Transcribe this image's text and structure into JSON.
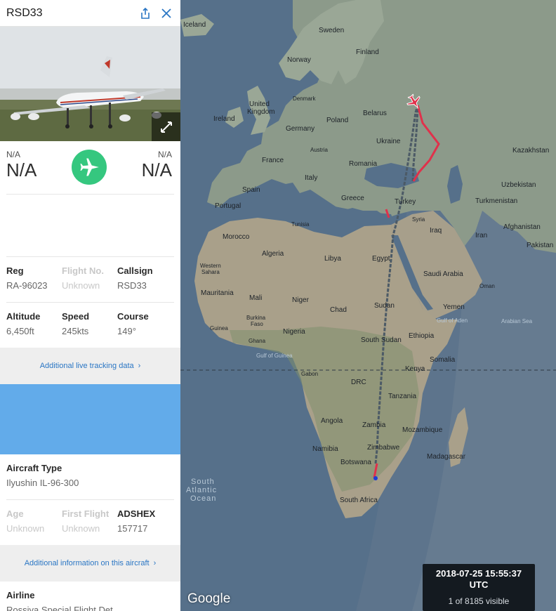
{
  "panel": {
    "title": "RSD33",
    "icons": [
      "share-icon",
      "close-icon",
      "expand-icon",
      "plane-icon"
    ],
    "origin": {
      "code": "N/A",
      "name": "N/A"
    },
    "destination": {
      "code": "N/A",
      "name": "N/A"
    },
    "status_color": "#35c77f",
    "info_row1": [
      {
        "label": "Reg",
        "value": "RA-96023",
        "dim": false
      },
      {
        "label": "Flight No.",
        "value": "Unknown",
        "dim": true
      },
      {
        "label": "Callsign",
        "value": "RSD33",
        "dim": false
      }
    ],
    "info_row2": [
      {
        "label": "Altitude",
        "value": "6,450ft"
      },
      {
        "label": "Speed",
        "value": "245kts"
      },
      {
        "label": "Course",
        "value": "149°"
      }
    ],
    "live_link": "Additional live tracking data",
    "aircraft_type": {
      "label": "Aircraft Type",
      "value": "Ilyushin IL-96-300"
    },
    "info_row3": [
      {
        "label": "Age",
        "value": "Unknown",
        "dim": true
      },
      {
        "label": "First Flight",
        "value": "Unknown",
        "dim": true
      },
      {
        "label": "ADSHEX",
        "value": "157717",
        "dim": false
      }
    ],
    "info_link": "Additional information on this aircraft",
    "airline": {
      "label": "Airline",
      "value": "Rossiya Special Flight Det"
    }
  },
  "map": {
    "labels": {
      "iceland": "Iceland",
      "sweden": "Sweden",
      "finland": "Finland",
      "norway": "Norway",
      "denmark": "Denmark",
      "uk": "United Kingdom",
      "ireland": "Ireland",
      "belarus": "Belarus",
      "poland": "Poland",
      "germany": "Germany",
      "ukraine": "Ukraine",
      "austria": "Austria",
      "kazakhstan": "Kazakhstan",
      "france": "France",
      "romania": "Romania",
      "italy": "Italy",
      "uzbekistan": "Uzbekistan",
      "spain": "Spain",
      "portugal": "Portugal",
      "greece": "Greece",
      "turkey": "Turkey",
      "turkmenistan": "Turkmenistan",
      "tunisia": "Tunisia",
      "syria": "Syria",
      "morocco": "Morocco",
      "iraq": "Iraq",
      "iran": "Iran",
      "afghanistan": "Afghanistan",
      "pakistan": "Pakistan",
      "algeria": "Algeria",
      "libya": "Libya",
      "egypt": "Egypt",
      "western_sahara": "Western\nSahara",
      "saudi": "Saudi Arabia",
      "oman": "Oman",
      "mauritania": "Mauritania",
      "mali": "Mali",
      "niger": "Niger",
      "sudan": "Sudan",
      "chad": "Chad",
      "yemen": "Yemen",
      "burkina": "Burkina\nFaso",
      "guinea": "Guinea",
      "nigeria": "Nigeria",
      "gulf_aden": "Gulf of Aden",
      "arabian_sea": "Arabian Sea",
      "ghana": "Ghana",
      "south_sudan": "South Sudan",
      "ethiopia": "Ethiopia",
      "gulf_guinea": "Gulf of Guinea",
      "somalia": "Somalia",
      "gabon": "Gabon",
      "kenya": "Kenya",
      "drc": "DRC",
      "tanzania": "Tanzania",
      "angola": "Angola",
      "zambia": "Zambia",
      "mozambique": "Mozambique",
      "namibia": "Namibia",
      "zimbabwe": "Zimbabwe",
      "madagascar": "Madagascar",
      "botswana": "Botswana",
      "south_atlantic": "South\nAtlantic\nOcean",
      "south_africa": "South Africa"
    },
    "track_color_red": "#e0314b",
    "track_color_gray": "#4c5a66",
    "timestamp": "2018-07-25 15:55:37\nUTC",
    "visible": "1 of 8185 visible",
    "logo": "Google"
  }
}
